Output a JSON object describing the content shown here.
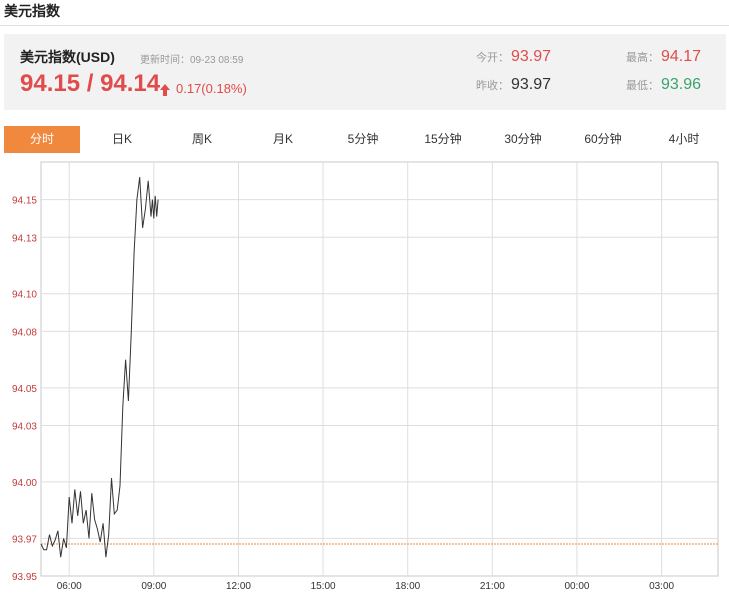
{
  "page_title": "美元指数",
  "quote": {
    "name": "美元指数(USD)",
    "update_label": "更新时间：09-23 08:59",
    "price": "94.15 / 94.14",
    "change": "0.17(0.18%)",
    "stats": {
      "open_label": "今开：",
      "open": "93.97",
      "prev_label": "昨收：",
      "prev": "93.97",
      "high_label": "最高：",
      "high": "94.17",
      "low_label": "最低：",
      "low": "93.96"
    }
  },
  "tabs": [
    "分时",
    "日K",
    "周K",
    "月K",
    "5分钟",
    "15分钟",
    "30分钟",
    "60分钟",
    "4小时"
  ],
  "active_tab": 0,
  "colors": {
    "up": "#e04b4b",
    "down": "#3aa36b",
    "active_tab": "#f0893e",
    "line": "#333333",
    "prev_close_line": "#f0893e"
  },
  "chart_data": {
    "type": "line",
    "title": "",
    "xlabel": "",
    "ylabel": "",
    "x_ticks": [
      "06:00",
      "09:00",
      "12:00",
      "15:00",
      "18:00",
      "21:00",
      "00:00",
      "03:00"
    ],
    "y_ticks": [
      "93.95",
      "93.97",
      "94.00",
      "94.03",
      "94.05",
      "94.08",
      "94.10",
      "94.13",
      "94.15"
    ],
    "ylim": [
      93.95,
      94.17
    ],
    "xlim_hours_from_0500": [
      0,
      24
    ],
    "grid": true,
    "reference_line": {
      "value": 93.967,
      "style": "dashed"
    },
    "series": [
      {
        "x": [
          0.0,
          0.1,
          0.2,
          0.3,
          0.4,
          0.5,
          0.6,
          0.7,
          0.8,
          0.9,
          1.0,
          1.1,
          1.2,
          1.3,
          1.4,
          1.5,
          1.6,
          1.7,
          1.8,
          1.9,
          2.0,
          2.1,
          2.2,
          2.3,
          2.4,
          2.5,
          2.6,
          2.7,
          2.8,
          2.9,
          3.0,
          3.1,
          3.2,
          3.3,
          3.4,
          3.5,
          3.6,
          3.7,
          3.8,
          3.9,
          3.95,
          4.0,
          4.05,
          4.1,
          4.15
        ],
        "y": [
          93.967,
          93.964,
          93.964,
          93.972,
          93.966,
          93.969,
          93.974,
          93.96,
          93.97,
          93.965,
          93.992,
          93.978,
          93.996,
          93.982,
          93.995,
          93.978,
          93.985,
          93.97,
          93.994,
          93.98,
          93.975,
          93.968,
          93.978,
          93.96,
          93.972,
          94.002,
          93.983,
          93.985,
          93.998,
          94.04,
          94.065,
          94.043,
          94.08,
          94.122,
          94.15,
          94.162,
          94.135,
          94.145,
          94.16,
          94.141,
          94.15,
          94.14,
          94.152,
          94.141,
          94.15
        ]
      }
    ]
  }
}
